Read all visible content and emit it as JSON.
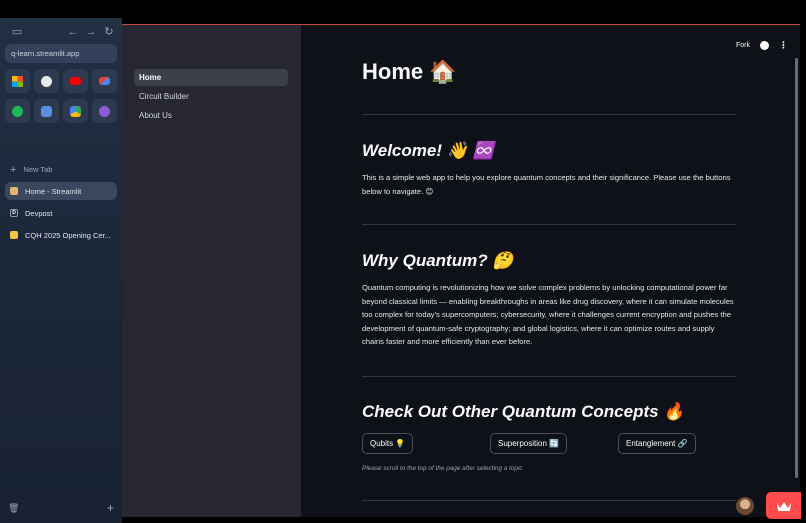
{
  "browser": {
    "url": "q-learn.streamlit.app",
    "new_tab_label": "New Tab",
    "tabs": [
      {
        "label": "Home - Streamlit",
        "active": true,
        "icon": "streamlit-home-icon",
        "color": "#e6b76a"
      },
      {
        "label": "Devpost",
        "active": false,
        "icon": "devpost-icon",
        "color": "#1d2b3f",
        "glyph": "D"
      },
      {
        "label": "CQH 2025 Opening Cer...",
        "active": false,
        "icon": "slides-icon",
        "color": "#f4c542"
      }
    ],
    "favorites": [
      {
        "icon": "microsoft-icon",
        "color": "#f25022"
      },
      {
        "icon": "chrome-icon",
        "color": "#e8e8e8"
      },
      {
        "icon": "youtube-icon",
        "color": "#ff0000"
      },
      {
        "icon": "gmail-icon",
        "color": "#ea4335"
      },
      {
        "icon": "spotify-icon",
        "color": "#1db954"
      },
      {
        "icon": "calculator-icon",
        "color": "#5a8ee0"
      },
      {
        "icon": "google-drive-icon",
        "color": "#34a853"
      },
      {
        "icon": "app-icon",
        "color": "#8e5bd6"
      }
    ]
  },
  "app": {
    "nav": [
      {
        "label": "Home",
        "active": true
      },
      {
        "label": "Circuit Builder",
        "active": false
      },
      {
        "label": "About Us",
        "active": false
      }
    ],
    "header": {
      "fork_label": "Fork"
    },
    "title": "Home 🏠",
    "welcome": {
      "heading": "Welcome! 👋 ♾️",
      "text": "This is a simple web app to help you explore quantum concepts and their significance. Please use the buttons below to navigate. 😊"
    },
    "why": {
      "heading": "Why Quantum? 🤔",
      "text": "Quantum computing is revolutionizing how we solve complex problems by unlocking computational power far beyond classical limits — enabling breakthroughs in areas like drug discovery, where it can simulate molecules too complex for today's supercomputers; cybersecurity, where it challenges current encryption and pushes the development of quantum-safe cryptography; and global logistics, where it can optimize routes and supply chains faster and more efficiently than ever before."
    },
    "concepts": {
      "heading": "Check Out Other Quantum Concepts 🔥",
      "buttons": [
        "Qubits 💡",
        "Superposition 🔄",
        "Entanglement 🔗"
      ],
      "caption": "Please scroll to the top of the page after selecting a topic"
    },
    "colors": {
      "accent": "#ff4b4b",
      "bg": "#0e1117",
      "sidebar": "#262730"
    }
  }
}
